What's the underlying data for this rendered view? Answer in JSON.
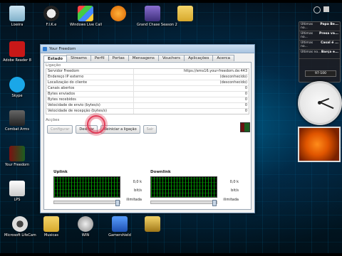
{
  "desktop": {
    "icons": [
      {
        "label": "Lixeira"
      },
      {
        "label": "F.I.K.e"
      },
      {
        "label": "Windows Live Call"
      },
      {
        "label": ""
      },
      {
        "label": "Grand Chase Season 2"
      },
      {
        "label": ""
      },
      {
        "label": "Adobe Reader 8"
      },
      {
        "label": "Skype"
      },
      {
        "label": "Combat Arms"
      },
      {
        "label": "Your Freedom"
      },
      {
        "label": "LPS"
      },
      {
        "label": "Microsoft LifeCam"
      },
      {
        "label": "Musicas"
      },
      {
        "label": "WIN"
      },
      {
        "label": "Gamershield"
      },
      {
        "label": ""
      }
    ]
  },
  "window": {
    "title": "Your Freedom",
    "tabs": [
      "Estado",
      "Streams",
      "Perfil",
      "Portas",
      "Mensagens",
      "Vouchers",
      "Aplicações",
      "Acerca"
    ],
    "active_tab": "Estado",
    "section_connection": "Ligação",
    "rows": [
      {
        "key": "Servidor Freedom",
        "value": "https://ems16.your-freedom.de:443"
      },
      {
        "key": "Endereço IP externo",
        "value": "(desconhecido)"
      },
      {
        "key": "Localização do cliente",
        "value": "(desconhecido)"
      },
      {
        "key": "Canais abertos",
        "value": "0"
      },
      {
        "key": "Bytes enviados",
        "value": "0"
      },
      {
        "key": "Bytes recebidos",
        "value": "0"
      },
      {
        "key": "Velocidade de envio (bytes/s)",
        "value": "0"
      },
      {
        "key": "Velocidade de recepção (bytes/s)",
        "value": "0"
      }
    ],
    "section_actions": "Acções",
    "buttons": {
      "configure": "Configurar",
      "connect": "Desligar",
      "reconnect": "Reiniciar a ligação",
      "exit": "Sair"
    },
    "uplink": {
      "title": "Uplink",
      "rate": "0,0 k",
      "unit": "bit/s",
      "limit": "ilimitada"
    },
    "downlink": {
      "title": "Downlink",
      "rate": "0,0 k",
      "unit": "bit/s",
      "limit": "ilimitada"
    }
  },
  "widgets": {
    "feeds": [
      {
        "source": "Últimas no...",
        "headline": "Papa Be..."
      },
      {
        "source": "Últimas no...",
        "headline": "Presa va..."
      },
      {
        "source": "Últimas no...",
        "headline": "Casal é ..."
      },
      {
        "source": "Últimas no...",
        "headline": "Barça e..."
      }
    ],
    "radio": "97-100",
    "clock": {
      "hour": 2,
      "minute": 19
    }
  }
}
